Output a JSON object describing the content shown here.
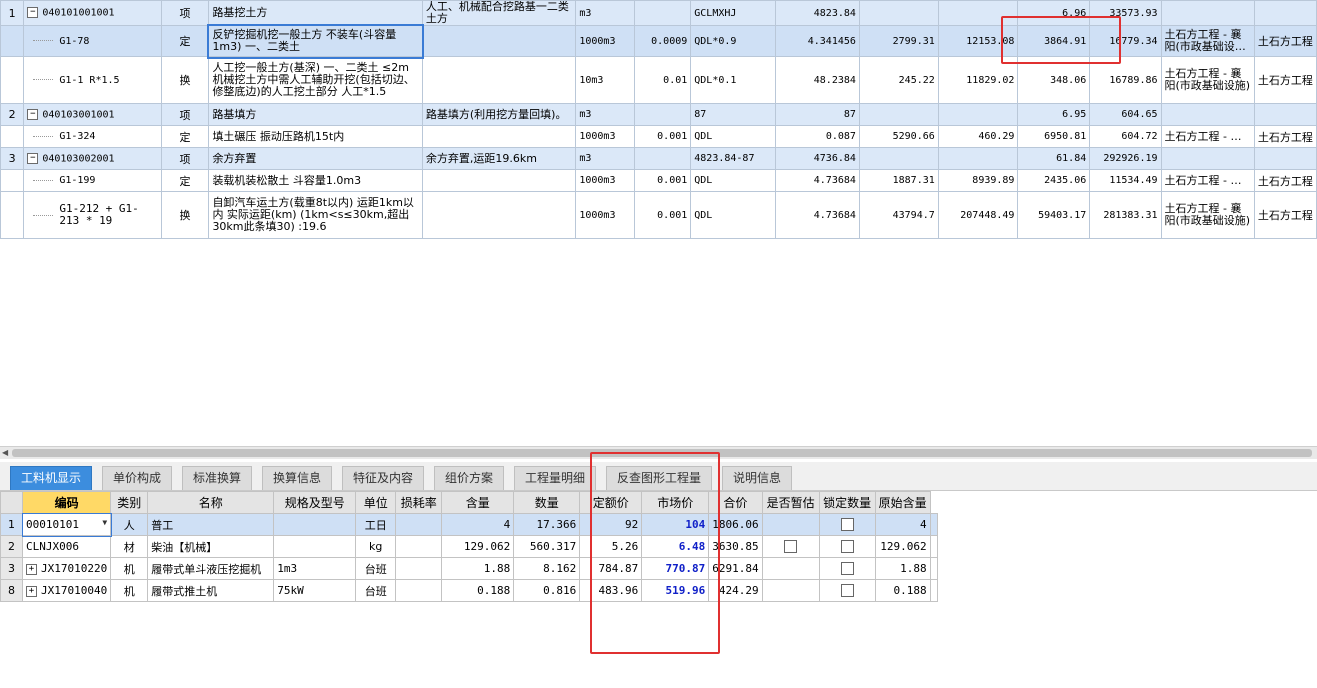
{
  "top_rows": [
    {
      "kind": "qd",
      "no": "1",
      "code": "040101001001",
      "type": "项",
      "name": "路基挖土方",
      "feature": "人工、机械配合挖路基一二类土方",
      "unit": "m3",
      "qty_expr": "",
      "quantity_formula": "GCLMXHJ",
      "quantity": "4823.84",
      "unit_price": "",
      "labor": "",
      "amount": "6.96",
      "total": "33573.93",
      "major": "",
      "fee": ""
    },
    {
      "kind": "sel",
      "no": "",
      "code": "G1-78",
      "type": "定",
      "name": "反铲挖掘机挖一般土方 不装车(斗容量1m3) 一、二类土",
      "feature": "",
      "unit": "1000m3",
      "qty_expr": "0.0009",
      "quantity_formula": "QDL*0.9",
      "quantity": "4.341456",
      "unit_price": "2799.31",
      "labor": "12153.08",
      "amount": "3864.91",
      "total": "16779.34",
      "major": "土石方工程 - 襄阳(市政基础设…",
      "fee": "土石方工程"
    },
    {
      "kind": "de",
      "no": "",
      "code": "G1-1 R*1.5",
      "type": "换",
      "name": "人工挖一般土方(基深) 一、二类土 ≤2m 机械挖土方中需人工辅助开挖(包括切边、修整底边)的人工挖土部分 人工*1.5",
      "feature": "",
      "unit": "10m3",
      "qty_expr": "0.01",
      "quantity_formula": "QDL*0.1",
      "quantity": "48.2384",
      "unit_price": "245.22",
      "labor": "11829.02",
      "amount": "348.06",
      "total": "16789.86",
      "major": "土石方工程 - 襄阳(市政基础设施)",
      "fee": "土石方工程"
    },
    {
      "kind": "qd",
      "no": "2",
      "code": "040103001001",
      "type": "项",
      "name": "路基填方",
      "feature": "路基填方(利用挖方量回填)。",
      "unit": "m3",
      "qty_expr": "",
      "quantity_formula": "87",
      "quantity": "87",
      "unit_price": "",
      "labor": "",
      "amount": "6.95",
      "total": "604.65",
      "major": "",
      "fee": ""
    },
    {
      "kind": "de",
      "no": "",
      "code": "G1-324",
      "type": "定",
      "name": "填土碾压 振动压路机15t内",
      "feature": "",
      "unit": "1000m3",
      "qty_expr": "0.001",
      "quantity_formula": "QDL",
      "quantity": "0.087",
      "unit_price": "5290.66",
      "labor": "460.29",
      "amount": "6950.81",
      "total": "604.72",
      "major": "土石方工程 - …",
      "fee": "土石方工程"
    },
    {
      "kind": "qd",
      "no": "3",
      "code": "040103002001",
      "type": "项",
      "name": "余方弃置",
      "feature": "余方弃置,运距19.6km",
      "unit": "m3",
      "qty_expr": "",
      "quantity_formula": "4823.84-87",
      "quantity": "4736.84",
      "unit_price": "",
      "labor": "",
      "amount": "61.84",
      "total": "292926.19",
      "major": "",
      "fee": ""
    },
    {
      "kind": "de",
      "no": "",
      "code": "G1-199",
      "type": "定",
      "name": "装载机装松散土 斗容量1.0m3",
      "feature": "",
      "unit": "1000m3",
      "qty_expr": "0.001",
      "quantity_formula": "QDL",
      "quantity": "4.73684",
      "unit_price": "1887.31",
      "labor": "8939.89",
      "amount": "2435.06",
      "total": "11534.49",
      "major": "土石方工程 - …",
      "fee": "土石方工程"
    },
    {
      "kind": "de",
      "no": "",
      "code": "G1-212 + G1-213 * 19",
      "type": "换",
      "name": "自卸汽车运土方(载重8t以内) 运距1km以内 实际运距(km) (1km<s≤30km,超出30km此条填30) :19.6",
      "feature": "",
      "unit": "1000m3",
      "qty_expr": "0.001",
      "quantity_formula": "QDL",
      "quantity": "4.73684",
      "unit_price": "43794.7",
      "labor": "207448.49",
      "amount": "59403.17",
      "total": "281383.31",
      "major": "土石方工程 - 襄阳(市政基础设施)",
      "fee": "土石方工程"
    }
  ],
  "tabs": [
    "工料机显示",
    "单价构成",
    "标准换算",
    "换算信息",
    "特征及内容",
    "组价方案",
    "工程量明细",
    "反查图形工程量",
    "说明信息"
  ],
  "bottom_headers": [
    "编码",
    "类别",
    "名称",
    "规格及型号",
    "单位",
    "损耗率",
    "含量",
    "数量",
    "定额价",
    "市场价",
    "合价",
    "是否暂估",
    "锁定数量",
    "原始含量"
  ],
  "bottom_rows": [
    {
      "idx": "1",
      "code": "00010101",
      "cat": "人",
      "name": "普工",
      "spec": "",
      "unit": "工日",
      "loss": "",
      "content": "4",
      "qty": "17.366",
      "quota": "92",
      "market": "104",
      "total": "1806.06",
      "est": false,
      "lock": true,
      "orig": "4",
      "expand": false
    },
    {
      "idx": "2",
      "code": "CLNJX006",
      "cat": "材",
      "name": "柴油【机械】",
      "spec": "",
      "unit": "kg",
      "loss": "",
      "content": "129.062",
      "qty": "560.317",
      "quota": "5.26",
      "market": "6.48",
      "total": "3630.85",
      "est": true,
      "lock": true,
      "orig": "129.062",
      "expand": false
    },
    {
      "idx": "3",
      "code": "JX17010220",
      "cat": "机",
      "name": "履带式单斗液压挖掘机",
      "spec": "1m3",
      "unit": "台班",
      "loss": "",
      "content": "1.88",
      "qty": "8.162",
      "quota": "784.87",
      "market": "770.87",
      "total": "6291.84",
      "est": false,
      "lock": true,
      "orig": "1.88",
      "expand": true
    },
    {
      "idx": "8",
      "code": "JX17010040",
      "cat": "机",
      "name": "履带式推土机",
      "spec": "75kW",
      "unit": "台班",
      "loss": "",
      "content": "0.188",
      "qty": "0.816",
      "quota": "483.96",
      "market": "519.96",
      "total": "424.29",
      "est": false,
      "lock": true,
      "orig": "0.188",
      "expand": true
    }
  ],
  "icons": {
    "collapse": "−",
    "expand": "+",
    "dropdown": "▼",
    "scroll_left": "◀"
  }
}
